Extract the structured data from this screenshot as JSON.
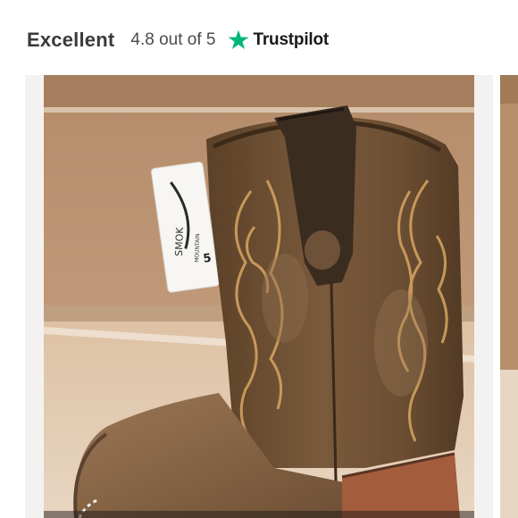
{
  "rating": {
    "label": "Excellent",
    "score_text": "4.8 out of 5",
    "provider": "Trustpilot",
    "star_color": "#00b67a"
  },
  "gallery": {
    "hang_tag_text": [
      "SMOK",
      "MOUNTAIN",
      "5"
    ],
    "colors": {
      "shelf": "#c79f7c",
      "boot_shaft": "#6b4e33",
      "boot_foot": "#8d6a4b",
      "stitching": "#d3a15e",
      "heel_panel": "#a35c3c"
    }
  }
}
